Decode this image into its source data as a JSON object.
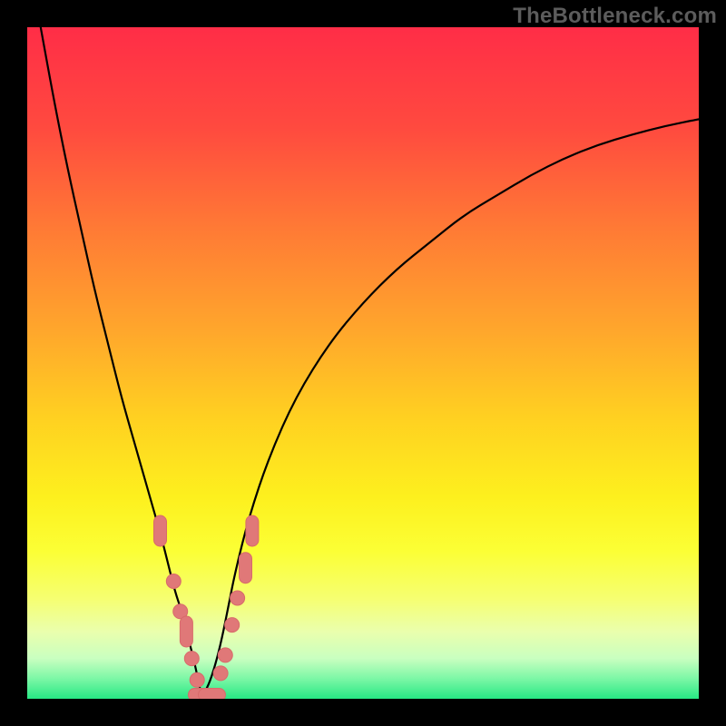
{
  "watermark": "TheBottleneck.com",
  "colors": {
    "bg": "#000000",
    "curve": "#000000",
    "marker_fill": "#e07878",
    "marker_stroke": "#d86a6a",
    "gradient_stops": [
      {
        "offset": 0.0,
        "color": "#ff2d47"
      },
      {
        "offset": 0.15,
        "color": "#ff4a3f"
      },
      {
        "offset": 0.3,
        "color": "#ff7a35"
      },
      {
        "offset": 0.45,
        "color": "#ffa62c"
      },
      {
        "offset": 0.58,
        "color": "#ffd021"
      },
      {
        "offset": 0.7,
        "color": "#fdf01e"
      },
      {
        "offset": 0.78,
        "color": "#fbff35"
      },
      {
        "offset": 0.85,
        "color": "#f6ff70"
      },
      {
        "offset": 0.9,
        "color": "#eaffad"
      },
      {
        "offset": 0.94,
        "color": "#c9ffc0"
      },
      {
        "offset": 0.97,
        "color": "#7cf7a6"
      },
      {
        "offset": 1.0,
        "color": "#27e884"
      }
    ]
  },
  "chart_data": {
    "type": "line",
    "title": "",
    "xlabel": "",
    "ylabel": "",
    "xlim": [
      0,
      100
    ],
    "ylim": [
      0,
      100
    ],
    "grid": false,
    "series": [
      {
        "name": "bottleneck-curve-left",
        "x": [
          2,
          4,
          6,
          8,
          10,
          12,
          14,
          16,
          18,
          20,
          21,
          22,
          23,
          24,
          25,
          25.5,
          26
        ],
        "y": [
          100,
          89,
          79,
          70,
          61,
          53,
          45,
          38,
          31,
          24,
          20,
          16,
          13,
          9,
          5,
          2.5,
          0.3
        ]
      },
      {
        "name": "bottleneck-curve-right",
        "x": [
          26,
          27,
          28,
          29,
          30,
          31,
          33,
          36,
          40,
          45,
          50,
          55,
          60,
          65,
          70,
          75,
          80,
          85,
          90,
          95,
          100
        ],
        "y": [
          0.3,
          2,
          5,
          9,
          14,
          19,
          27,
          36,
          45,
          53,
          59,
          64,
          68,
          72,
          75,
          78,
          80.5,
          82.5,
          84,
          85.3,
          86.3
        ]
      }
    ],
    "markers": [
      {
        "x": 19.8,
        "y": 25.0,
        "shape": "pill",
        "orient": "v"
      },
      {
        "x": 21.8,
        "y": 17.5,
        "shape": "circle"
      },
      {
        "x": 22.8,
        "y": 13.0,
        "shape": "circle"
      },
      {
        "x": 23.7,
        "y": 10.0,
        "shape": "pill",
        "orient": "v"
      },
      {
        "x": 24.5,
        "y": 6.0,
        "shape": "circle"
      },
      {
        "x": 25.3,
        "y": 2.8,
        "shape": "circle"
      },
      {
        "x": 26.0,
        "y": 0.6,
        "shape": "pill",
        "orient": "h"
      },
      {
        "x": 27.5,
        "y": 0.6,
        "shape": "pill",
        "orient": "h"
      },
      {
        "x": 28.8,
        "y": 3.8,
        "shape": "circle"
      },
      {
        "x": 29.5,
        "y": 6.5,
        "shape": "circle"
      },
      {
        "x": 30.5,
        "y": 11.0,
        "shape": "circle"
      },
      {
        "x": 31.3,
        "y": 15.0,
        "shape": "circle"
      },
      {
        "x": 32.5,
        "y": 19.5,
        "shape": "pill",
        "orient": "v"
      },
      {
        "x": 33.5,
        "y": 25.0,
        "shape": "pill",
        "orient": "v"
      }
    ]
  }
}
